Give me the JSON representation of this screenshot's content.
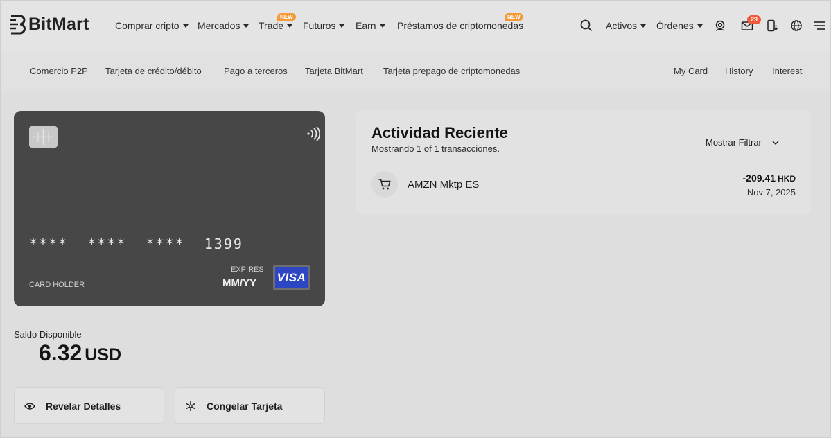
{
  "brand": {
    "name": "BitMart"
  },
  "topnav": {
    "items": [
      {
        "label": "Comprar cripto",
        "dropdown": true
      },
      {
        "label": "Mercados",
        "dropdown": true
      },
      {
        "label": "Trade",
        "dropdown": true,
        "badge": "NEW"
      },
      {
        "label": "Futuros",
        "dropdown": true
      },
      {
        "label": "Earn",
        "dropdown": true
      },
      {
        "label": "Préstamos de criptomonedas",
        "dropdown": false,
        "badge": "NEW"
      }
    ],
    "right": {
      "search_icon": "search-icon",
      "assets_label": "Activos",
      "orders_label": "Órdenes",
      "support_icon": "support-icon",
      "mail_icon": "mail-icon",
      "mail_count": "29",
      "download_icon": "download-app-icon",
      "language_icon": "globe-icon",
      "menu_icon": "menu-icon"
    }
  },
  "subnav": {
    "left": [
      "Comercio P2P",
      "Tarjeta de crédito/débito",
      "Pago a terceros",
      "Tarjeta BitMart",
      "Tarjeta prepago de criptomonedas"
    ],
    "right": [
      "My Card",
      "History",
      "Interest"
    ]
  },
  "card": {
    "number": "****  ****  ****  1399",
    "holder_label": "CARD HOLDER",
    "expires_label": "EXPIRES",
    "expires_value": "MM/YY",
    "network": "VISA",
    "color": "#474747"
  },
  "balance": {
    "label": "Saldo Disponible",
    "amount": "6.32",
    "currency": "USD"
  },
  "actions": {
    "reveal_label": "Revelar Detalles",
    "freeze_label": "Congelar Tarjeta"
  },
  "activity": {
    "title": "Actividad Reciente",
    "subtitle": "Mostrando 1 of 1 transacciones.",
    "filter_label": "Mostrar Filtrar",
    "transactions": [
      {
        "merchant": "AMZN Mktp ES",
        "amount": "-209.41",
        "currency": "HKD",
        "date": "Nov 7, 2025",
        "icon": "cart-icon"
      }
    ]
  },
  "colors": {
    "badge": "#f39a3a",
    "mail_badge": "#ef5a3c",
    "visa": "#2d46c4"
  }
}
